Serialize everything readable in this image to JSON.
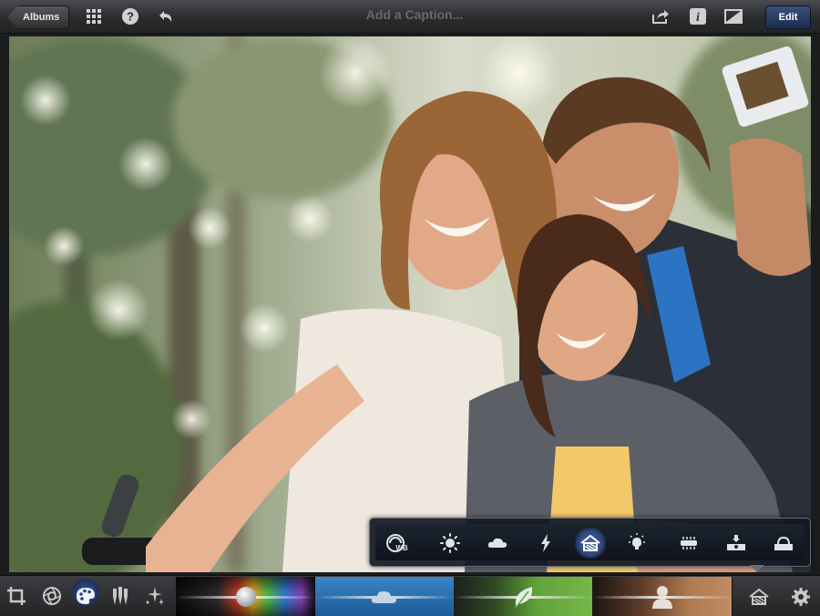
{
  "toolbar": {
    "back_label": "Albums",
    "caption_placeholder": "Add a Caption...",
    "edit_label": "Edit",
    "icons": [
      "grid-icon",
      "help-icon",
      "undo-icon",
      "share-icon",
      "info-icon",
      "compare-icon"
    ]
  },
  "photo": {
    "subject": "family-selfie-photo"
  },
  "adjust_popup": {
    "tools": [
      "white-balance-icon",
      "brightness-icon",
      "cloudy-icon",
      "flash-icon",
      "shade-icon",
      "incandescent-icon",
      "fluorescent-icon",
      "underwater-icon",
      "underwater-alt-icon"
    ],
    "tool_labels": [
      "WB"
    ],
    "selected_tool": "shade-icon"
  },
  "bottombar": {
    "tools": [
      "crop-icon",
      "exposure-icon",
      "color-palette-icon",
      "brushes-icon",
      "effects-icon"
    ],
    "selected_tool": "color-palette-icon",
    "strips": [
      "saturation-slider",
      "sky-slider",
      "foliage-slider",
      "skin-tone-slider"
    ],
    "right_tools": [
      "shade-icon",
      "settings-icon"
    ]
  },
  "colors": {
    "accent": "#3b5a9c",
    "toolbar_bg": "#2a2b2d",
    "sky_strip": "#2f6fb0",
    "foliage_strip": "#5ea33a",
    "skin_strip": "#b07a52"
  }
}
